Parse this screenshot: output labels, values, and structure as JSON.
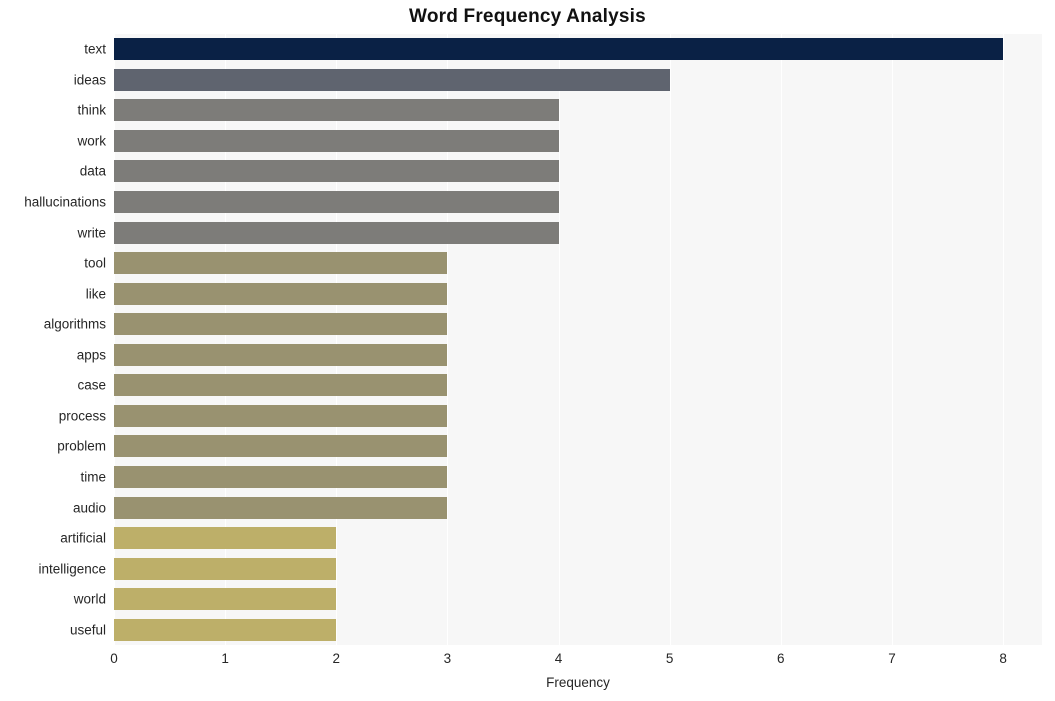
{
  "chart_data": {
    "type": "bar",
    "orientation": "horizontal",
    "title": "Word Frequency Analysis",
    "xlabel": "Frequency",
    "ylabel": "",
    "xlim": [
      0,
      8.35
    ],
    "ylim": [
      0,
      20
    ],
    "grid": "vertical-white",
    "legend": null,
    "x_ticks": [
      0,
      1,
      2,
      3,
      4,
      5,
      6,
      7,
      8
    ],
    "x_tick_labels": [
      "0",
      "1",
      "2",
      "3",
      "4",
      "5",
      "6",
      "7",
      "8"
    ],
    "categories": [
      "text",
      "ideas",
      "think",
      "work",
      "data",
      "hallucinations",
      "write",
      "tool",
      "like",
      "algorithms",
      "apps",
      "case",
      "process",
      "problem",
      "time",
      "audio",
      "artificial",
      "intelligence",
      "world",
      "useful"
    ],
    "values": [
      8,
      5,
      4,
      4,
      4,
      4,
      4,
      3,
      3,
      3,
      3,
      3,
      3,
      3,
      3,
      3,
      2,
      2,
      2,
      2
    ],
    "bar_colors": [
      "#0a2145",
      "#5f646f",
      "#7d7c79",
      "#7d7c79",
      "#7d7c79",
      "#7d7c79",
      "#7d7c79",
      "#999270",
      "#999270",
      "#999270",
      "#999270",
      "#999270",
      "#999270",
      "#999270",
      "#999270",
      "#999270",
      "#bdaf69",
      "#bdaf69",
      "#bdaf69",
      "#bdaf69"
    ]
  },
  "style": {
    "plot_background": "#f7f7f7",
    "figure_background": "#ffffff",
    "gridline_color": "#ffffff",
    "text_color": "#262626",
    "title_color": "#111111"
  }
}
